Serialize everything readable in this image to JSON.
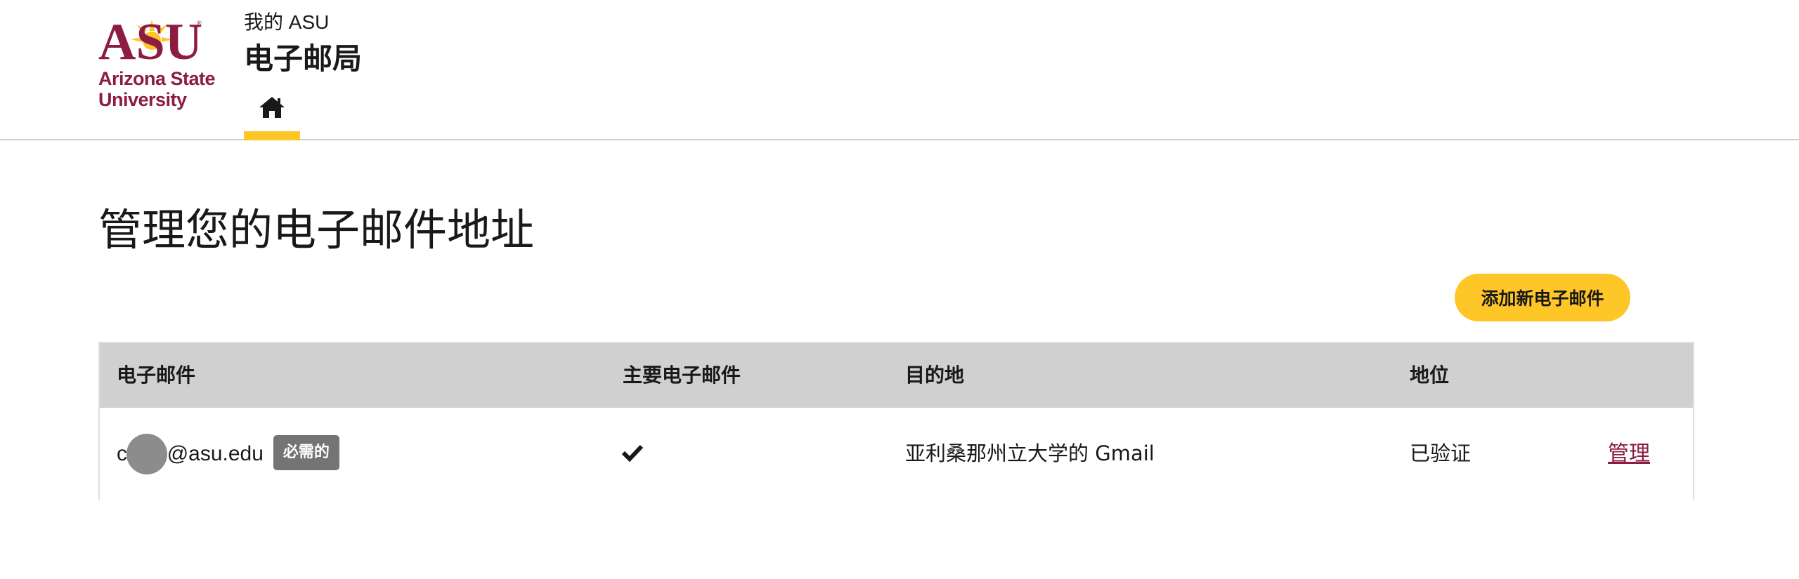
{
  "header": {
    "logo": {
      "line1": "Arizona State",
      "line2": "University",
      "brand_maroon": "#8C1D40",
      "brand_gold": "#FFC627",
      "mark_text": "ASU"
    },
    "site_subtitle": "我的 ASU",
    "site_title": "电子邮局",
    "nav": {
      "home_icon": "home-icon"
    }
  },
  "main": {
    "heading": "管理您的电子邮件地址",
    "add_button": "添加新电子邮件",
    "table": {
      "columns": [
        "电子邮件",
        "主要电子邮件",
        "目的地",
        "地位"
      ],
      "rows": [
        {
          "email": "c   ey5@asu.edu",
          "badge": "必需的",
          "primary_icon": "checkmark-icon",
          "destination": "亚利桑那州立大学的 Gmail",
          "status": "已验证",
          "action": "管理"
        }
      ]
    }
  }
}
